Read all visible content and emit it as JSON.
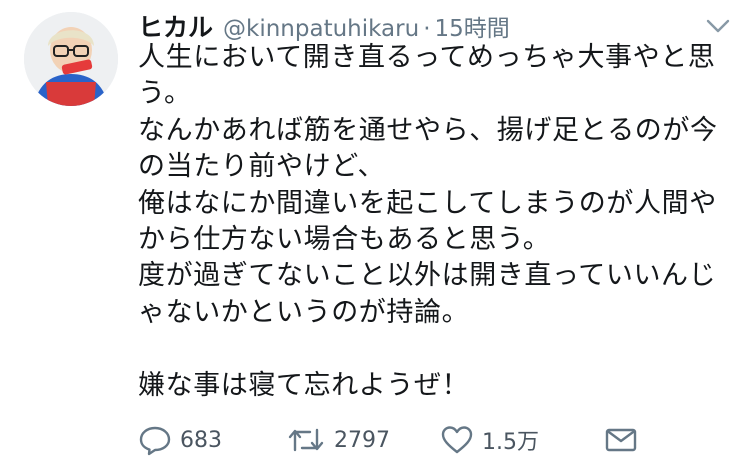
{
  "author": {
    "name": "ヒカル",
    "handle": "@kinnpatuhikaru",
    "separator": "·",
    "time": "15時間"
  },
  "tweet": {
    "lines": [
      "人生において開き直るってめっちゃ大事やと思",
      "う。",
      "なんかあれば筋を通せやら、揚げ足とるのが今",
      "の当たり前やけど、",
      "俺はなにか間違いを起こしてしまうのが人間や",
      "から仕方ない場合もあると思う。",
      "度が過ぎてないこと以外は開き直っていいんじ",
      "ゃないかというのが持論。",
      "",
      "嫌な事は寝て忘れようぜ！"
    ]
  },
  "actions": {
    "reply_count": "683",
    "retweet_count": "2797",
    "like_count": "1.5万"
  },
  "icons": {
    "reply": "reply-icon",
    "retweet": "retweet-icon",
    "like": "heart-icon",
    "dm": "envelope-icon",
    "menu": "chevron-down-icon"
  },
  "colors": {
    "text": "#14171a",
    "secondary": "#657786"
  }
}
